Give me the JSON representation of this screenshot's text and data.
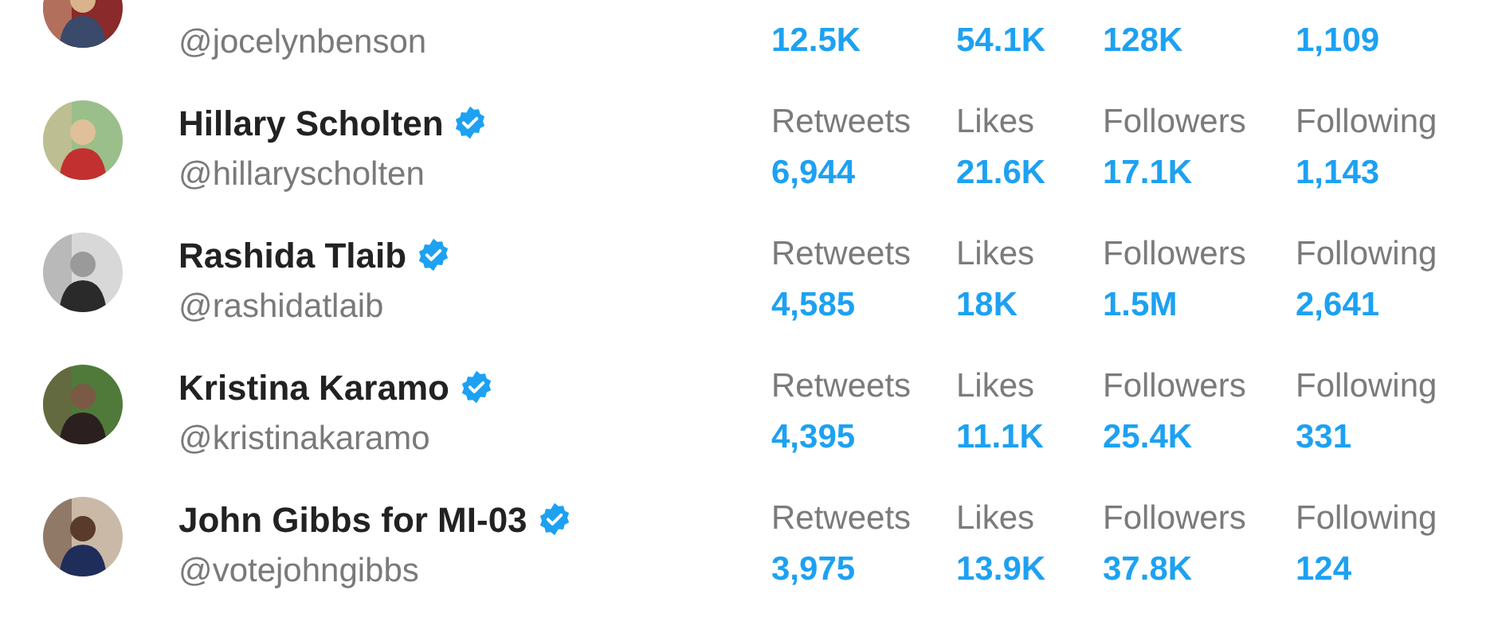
{
  "accounts": [
    {
      "handle": "@jocelynbenson",
      "stats": [
        {
          "value": "12.5K"
        },
        {
          "value": "54.1K"
        },
        {
          "value": "128K"
        },
        {
          "value": "1,109"
        }
      ]
    },
    {
      "name": "Hillary Scholten",
      "handle": "@hillaryscholten",
      "verified": true,
      "stats": [
        {
          "label": "Retweets",
          "value": "6,944"
        },
        {
          "label": "Likes",
          "value": "21.6K"
        },
        {
          "label": "Followers",
          "value": "17.1K"
        },
        {
          "label": "Following",
          "value": "1,143"
        }
      ]
    },
    {
      "name": "Rashida Tlaib",
      "handle": "@rashidatlaib",
      "verified": true,
      "stats": [
        {
          "label": "Retweets",
          "value": "4,585"
        },
        {
          "label": "Likes",
          "value": "18K"
        },
        {
          "label": "Followers",
          "value": "1.5M"
        },
        {
          "label": "Following",
          "value": "2,641"
        }
      ]
    },
    {
      "name": "Kristina Karamo",
      "handle": "@kristinakaramo",
      "verified": true,
      "stats": [
        {
          "label": "Retweets",
          "value": "4,395"
        },
        {
          "label": "Likes",
          "value": "11.1K"
        },
        {
          "label": "Followers",
          "value": "25.4K"
        },
        {
          "label": "Following",
          "value": "331"
        }
      ]
    },
    {
      "name": "John Gibbs for MI-03",
      "handle": "@votejohngibbs",
      "verified": true,
      "stats": [
        {
          "label": "Retweets",
          "value": "3,975"
        },
        {
          "label": "Likes",
          "value": "13.9K"
        },
        {
          "label": "Followers",
          "value": "37.8K"
        },
        {
          "label": "Following",
          "value": "124"
        }
      ]
    }
  ]
}
